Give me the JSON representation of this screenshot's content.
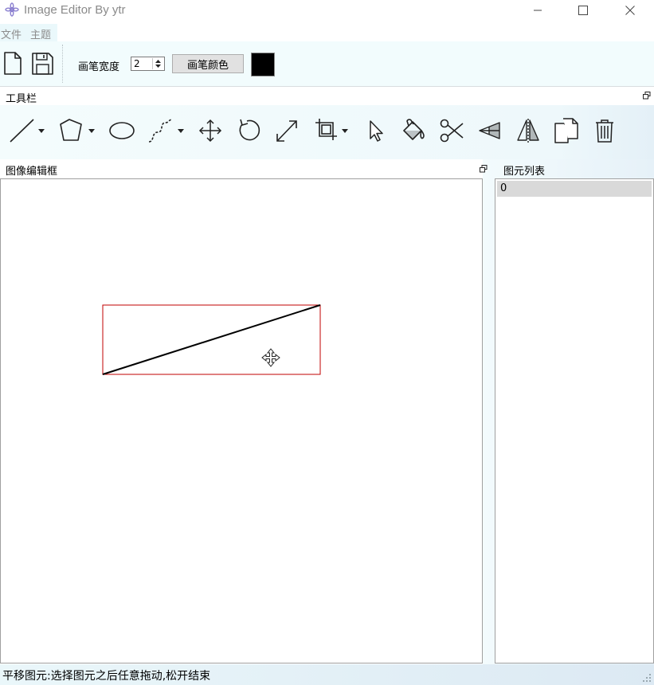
{
  "window": {
    "title": "Image Editor By ytr",
    "controls": [
      "minimize-icon",
      "maximize-icon",
      "close-icon"
    ]
  },
  "menu": {
    "items": [
      {
        "label": "文件"
      },
      {
        "label": "主题"
      }
    ]
  },
  "toolbar": {
    "new_icon": "new-file-icon",
    "save_icon": "save-icon",
    "pen_width_label": "画笔宽度",
    "pen_width_value": "2",
    "pen_color_button": "画笔颜色",
    "pen_color": "#000000"
  },
  "tools_dock": {
    "title": "工具栏",
    "tools": [
      {
        "name": "line",
        "icon": "line-tool-icon",
        "has_menu": true
      },
      {
        "name": "polygon",
        "icon": "polygon-tool-icon",
        "has_menu": true
      },
      {
        "name": "ellipse",
        "icon": "ellipse-tool-icon",
        "has_menu": false
      },
      {
        "name": "curve",
        "icon": "curve-tool-icon",
        "has_menu": true
      },
      {
        "name": "translate",
        "icon": "move-icon",
        "has_menu": false
      },
      {
        "name": "rotate",
        "icon": "rotate-icon",
        "has_menu": false
      },
      {
        "name": "scale",
        "icon": "scale-icon",
        "has_menu": false
      },
      {
        "name": "clip",
        "icon": "crop-icon",
        "has_menu": true
      },
      {
        "name": "select",
        "icon": "cursor-icon",
        "has_menu": false
      },
      {
        "name": "fill",
        "icon": "paint-bucket-icon",
        "has_menu": false
      },
      {
        "name": "cut",
        "icon": "scissors-icon",
        "has_menu": false
      },
      {
        "name": "flip-horizontal",
        "icon": "flip-horizontal-icon",
        "has_menu": false
      },
      {
        "name": "flip-vertical",
        "icon": "flip-vertical-icon",
        "has_menu": false
      },
      {
        "name": "copy",
        "icon": "copy-icon",
        "has_menu": false
      },
      {
        "name": "delete",
        "icon": "trash-icon",
        "has_menu": false
      }
    ]
  },
  "editor_dock": {
    "title": "图像编辑框",
    "selection_color": "#c00000",
    "stroke_color": "#000000"
  },
  "list_dock": {
    "title": "图元列表",
    "items": [
      "0"
    ]
  },
  "status": {
    "text": "平移图元:选择图元之后任意拖动,松开结束"
  },
  "colors": {
    "dock_background": "#f2fcfd",
    "selected_list_row": "#d9d9d9"
  }
}
